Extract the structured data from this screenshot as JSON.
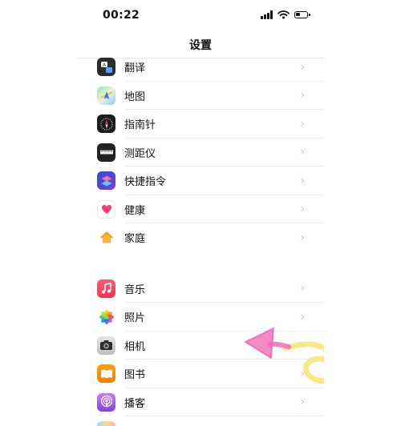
{
  "status_bar": {
    "time": "00:22",
    "battery_level": 0.45
  },
  "nav": {
    "title": "设置"
  },
  "colors": {
    "chevron": "#c7c7cc",
    "scribble_pink": "#f06bb6",
    "scribble_yellow": "#f7e67a"
  },
  "sections": [
    {
      "items": [
        {
          "label": "翻译",
          "icon": "translate-icon"
        },
        {
          "label": "地图",
          "icon": "maps-icon"
        },
        {
          "label": "指南针",
          "icon": "compass-icon"
        },
        {
          "label": "测距仪",
          "icon": "measure-icon"
        },
        {
          "label": "快捷指令",
          "icon": "shortcuts-icon"
        },
        {
          "label": "健康",
          "icon": "health-icon"
        },
        {
          "label": "家庭",
          "icon": "home-icon"
        }
      ]
    },
    {
      "items": [
        {
          "label": "音乐",
          "icon": "music-icon"
        },
        {
          "label": "照片",
          "icon": "photos-icon"
        },
        {
          "label": "相机",
          "icon": "camera-icon"
        },
        {
          "label": "图书",
          "icon": "books-icon"
        },
        {
          "label": "播客",
          "icon": "podcasts-icon"
        }
      ]
    }
  ]
}
